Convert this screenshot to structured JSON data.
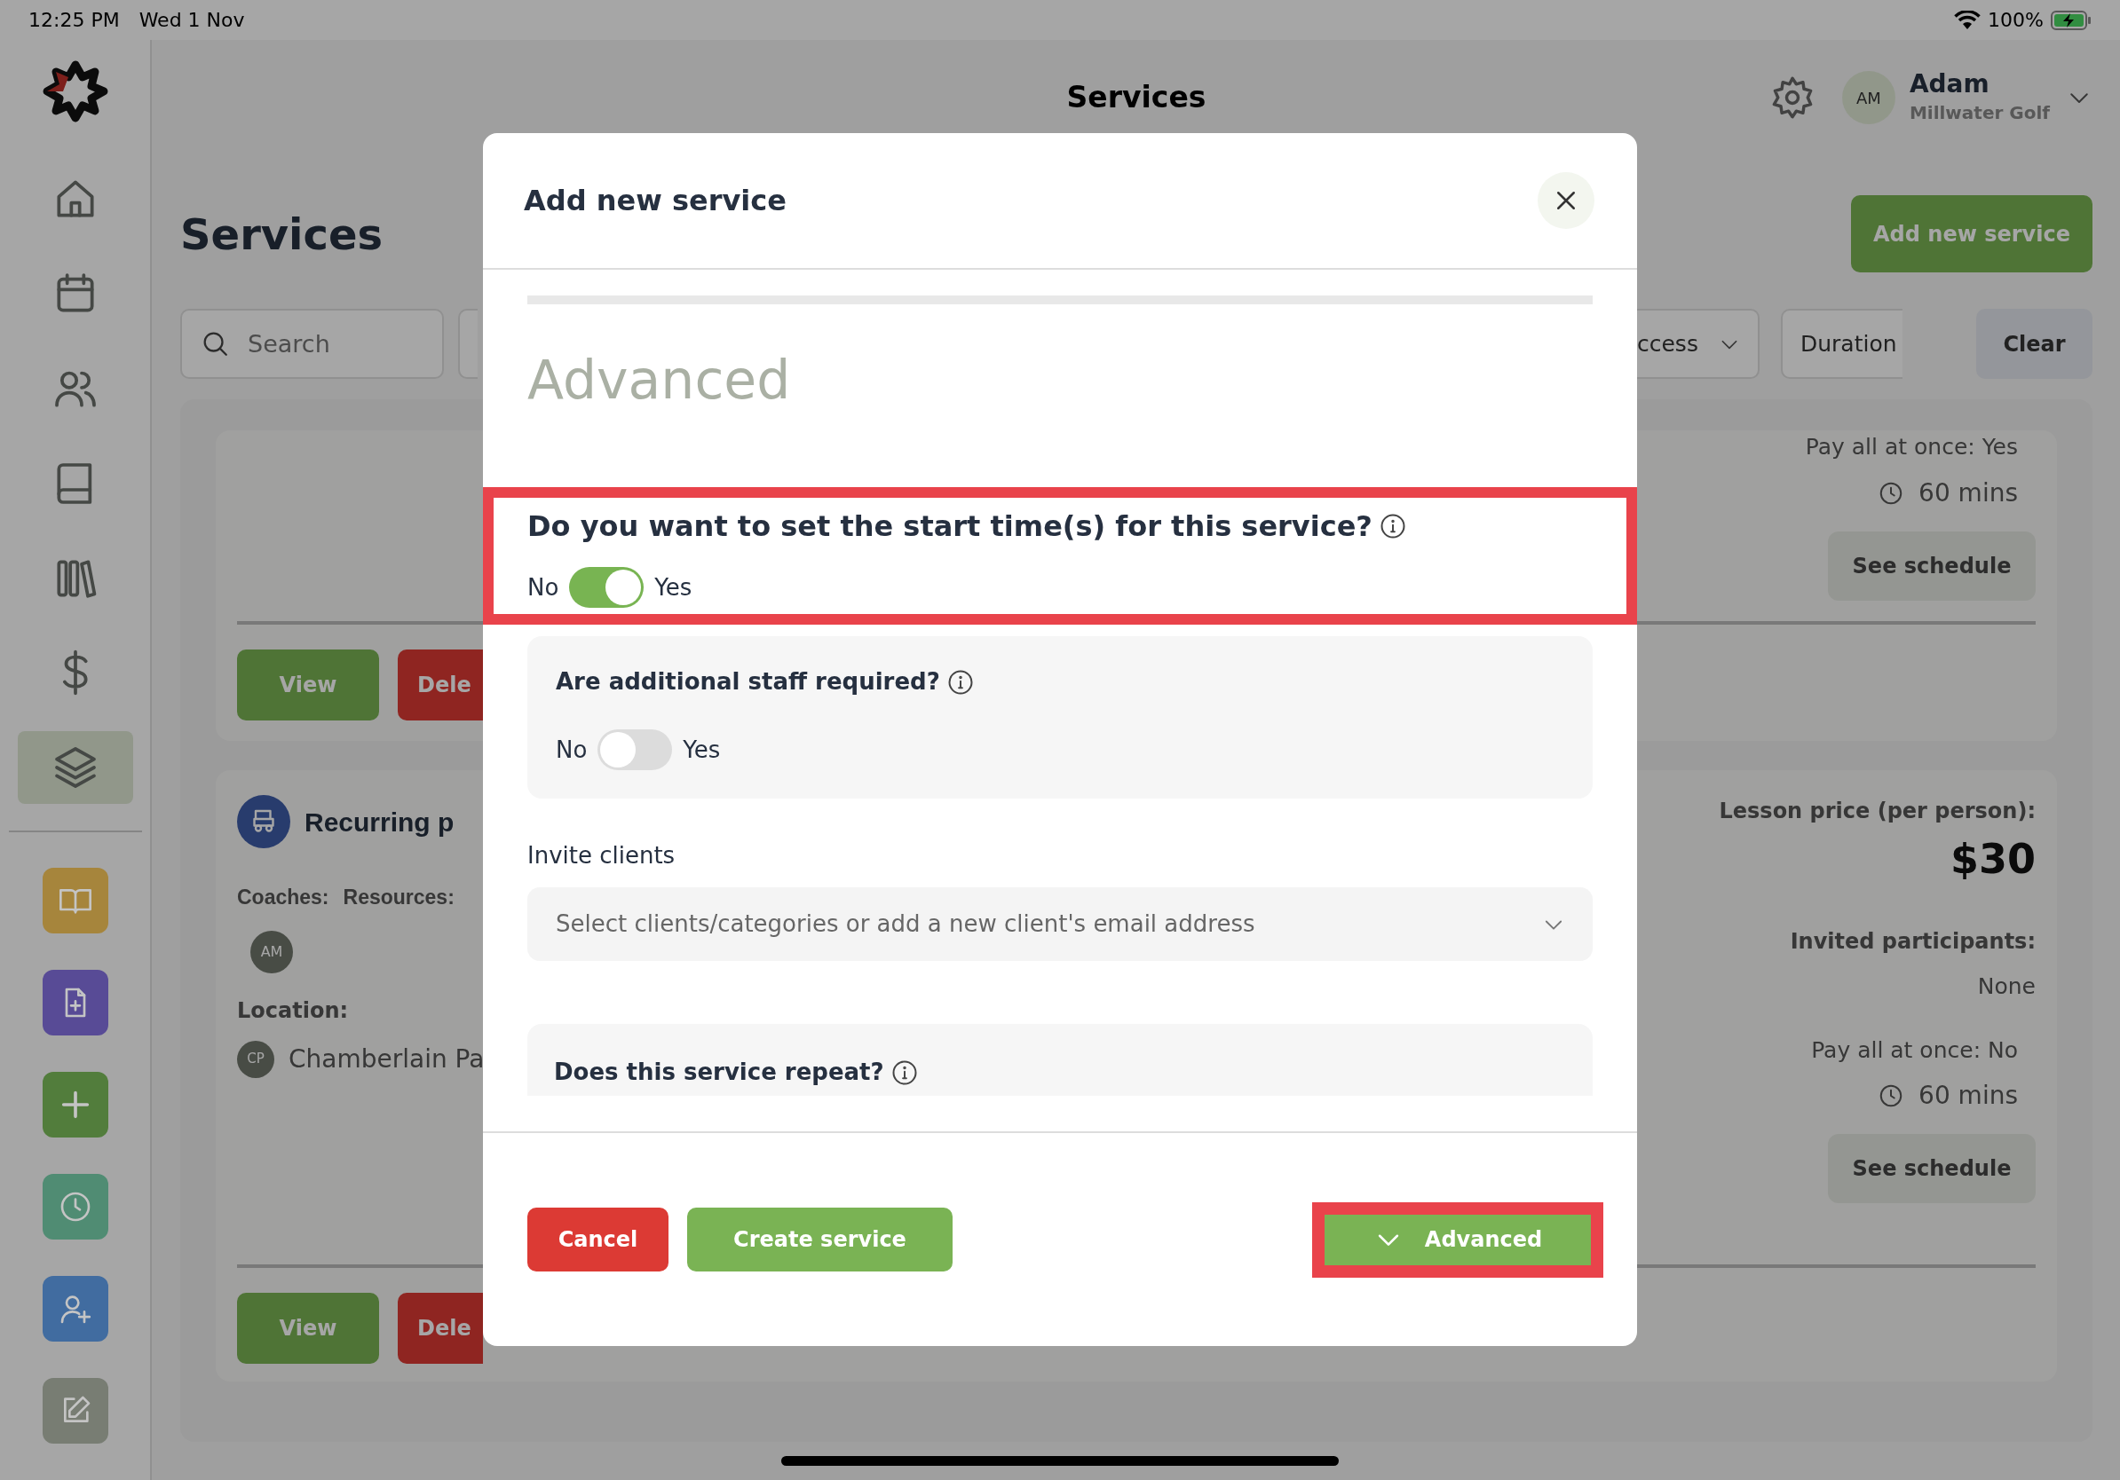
{
  "status_bar": {
    "time": "12:25 PM",
    "date": "Wed 1 Nov",
    "battery": "100%"
  },
  "sidebar": {
    "nav": [
      {
        "selected": false
      },
      {
        "selected": false
      },
      {
        "selected": false
      },
      {
        "selected": false
      },
      {
        "selected": false
      },
      {
        "selected": false
      },
      {
        "selected": true
      }
    ],
    "shortcuts": [
      {
        "color": "#a6853c"
      },
      {
        "color": "#584b96"
      },
      {
        "color": "#527d3c"
      },
      {
        "color": "#508c73"
      },
      {
        "color": "#416ca0"
      },
      {
        "color": "#787d73"
      }
    ]
  },
  "header": {
    "title": "Services",
    "user": {
      "initials": "AM",
      "name": "Adam",
      "club": "Millwater Golf"
    }
  },
  "page": {
    "title": "Services",
    "add_button": "Add new service",
    "filters": {
      "placeholder": "Search",
      "chips": [
        {
          "kind": "dropdown",
          "label": "ccess"
        },
        {
          "kind": "plain",
          "label": "Duration"
        }
      ],
      "clear": "Clear"
    },
    "cards": [
      {
        "pay_all": "Pay all at once: Yes",
        "duration": "60 mins",
        "schedule": "See schedule",
        "view": "View",
        "delete": "Dele"
      },
      {
        "title": "Recurring p",
        "coaches_label": "Coaches:",
        "resources_label": "Resources:",
        "coach_initials": "AM",
        "location_label": "Location:",
        "location_initials": "CP",
        "location": "Chamberlain Pa",
        "price_label": "Lesson price (per person):",
        "price": "$30",
        "participants_label": "Invited participants:",
        "participants": "None",
        "pay_all": "Pay all at once: No",
        "duration": "60 mins",
        "schedule": "See schedule",
        "view": "View",
        "delete": "Dele"
      }
    ]
  },
  "modal": {
    "title": "Add new service",
    "section": "Advanced",
    "questions": [
      {
        "kind": "toggle",
        "text": "Do you want to set the start time(s) for this service?",
        "off_label": "No",
        "on_label": "Yes",
        "on": true,
        "highlighted": true,
        "panel": false
      },
      {
        "kind": "toggle",
        "text": "Are additional staff required?",
        "off_label": "No",
        "on_label": "Yes",
        "on": false,
        "highlighted": false,
        "panel": true
      },
      {
        "kind": "select",
        "label": "Invite clients",
        "placeholder": "Select clients/categories or add a new client's email address"
      },
      {
        "kind": "heading",
        "text": "Does this service repeat?",
        "panel": true
      }
    ],
    "buttons": [
      {
        "kind": "danger",
        "label": "Cancel",
        "highlighted": false
      },
      {
        "kind": "primary",
        "label": "Create service",
        "highlighted": false
      },
      {
        "kind": "expand",
        "label": "Advanced",
        "highlighted": true
      }
    ]
  }
}
